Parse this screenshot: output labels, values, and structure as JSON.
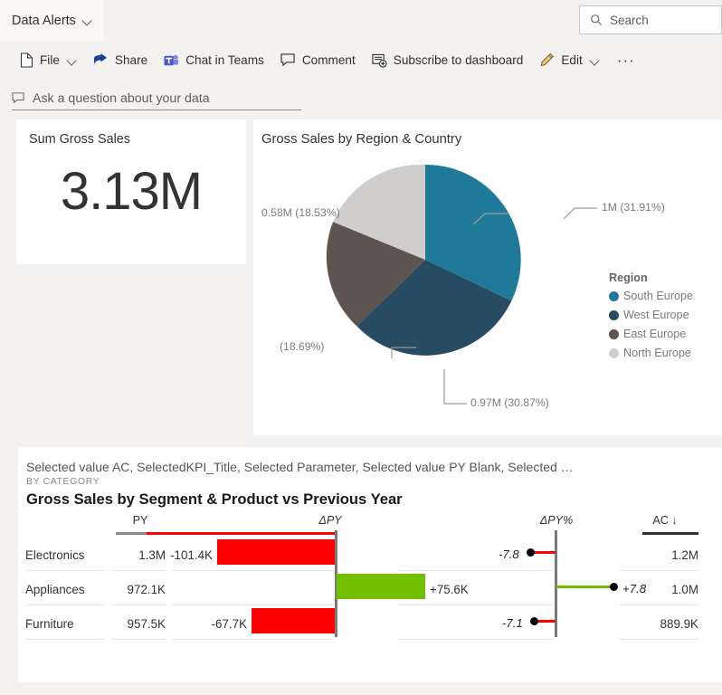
{
  "header": {
    "title": "Data Alerts",
    "chevron_icon": "chevron-down-icon",
    "search": {
      "icon": "search-icon",
      "placeholder": "Search",
      "value": ""
    }
  },
  "toolbar": {
    "items": [
      {
        "label": "File",
        "icon": "file-icon",
        "has_chevron": true
      },
      {
        "label": "Share",
        "icon": "share-icon",
        "has_chevron": false
      },
      {
        "label": "Chat in Teams",
        "icon": "teams-icon",
        "has_chevron": false
      },
      {
        "label": "Comment",
        "icon": "comment-icon",
        "has_chevron": false
      },
      {
        "label": "Subscribe to dashboard",
        "icon": "subscribe-icon",
        "has_chevron": false
      },
      {
        "label": "Edit",
        "icon": "pencil-icon",
        "has_chevron": true
      }
    ],
    "overflow_label": "···"
  },
  "qna": {
    "icon": "comment-icon",
    "placeholder": "Ask a question about your data",
    "value": ""
  },
  "kpi": {
    "title": "Sum Gross Sales",
    "value": "3.13M"
  },
  "pie": {
    "title": "Gross Sales by Region & Country",
    "legend_title": "Region"
  },
  "variance": {
    "subtitle": "Selected value AC, SelectedKPI_Title, Selected Parameter, Selected value PY Blank, Selected …",
    "by_category": "BY CATEGORY",
    "title": "Gross Sales by Segment & Product vs Previous Year"
  },
  "chart_data": [
    {
      "type": "pie",
      "title": "Gross Sales by Region & Country",
      "legend_title": "Region",
      "legend_position": "right",
      "slices": [
        {
          "name": "South Europe",
          "label": "1M (31.91%)",
          "value": 1.0,
          "percent": 31.91,
          "color": "#1f7a99"
        },
        {
          "name": "West Europe",
          "label": "0.97M (30.87%)",
          "value": 0.97,
          "percent": 30.87,
          "color": "#274b63"
        },
        {
          "name": "East Europe",
          "label": "(18.69%)",
          "value": 0.585,
          "percent": 18.69,
          "color": "#5d5450"
        },
        {
          "name": "North Europe",
          "label": "0.58M (18.53%)",
          "value": 0.58,
          "percent": 18.53,
          "color": "#d0cdcd"
        }
      ]
    },
    {
      "type": "bar",
      "title": "Gross Sales by Segment & Product vs Previous Year",
      "subtitle": "Selected value AC, SelectedKPI_Title, Selected Parameter, Selected value PY Blank, Selected …",
      "columns": [
        "PY",
        "ΔPY",
        "ΔPY%",
        "AC ↓"
      ],
      "categories": [
        "Electronics",
        "Appliances",
        "Furniture"
      ],
      "series": [
        {
          "name": "PY",
          "values": [
            1300000,
            972100,
            957500
          ],
          "labels": [
            "1.3M",
            "972.1K",
            "957.5K"
          ]
        },
        {
          "name": "ΔPY",
          "values": [
            -101400,
            75600,
            -67700
          ],
          "labels": [
            "-101.4K",
            "+75.6K",
            "-67.7K"
          ]
        },
        {
          "name": "ΔPY%",
          "values": [
            -7.8,
            7.8,
            -7.1
          ],
          "labels": [
            "-7.8",
            "+7.8",
            "-7.1"
          ]
        },
        {
          "name": "AC",
          "values": [
            1200000,
            1000000,
            889900
          ],
          "labels": [
            "1.2M",
            "1.0M",
            "889.9K"
          ]
        }
      ],
      "positive_color": "#70c000",
      "negative_color": "#ff0000"
    }
  ],
  "colors": {
    "page_bg": "#f3f2f1",
    "card_bg": "#ffffff",
    "positive": "#70c000",
    "negative": "#ff0000",
    "axis": "#7a7a7a"
  }
}
